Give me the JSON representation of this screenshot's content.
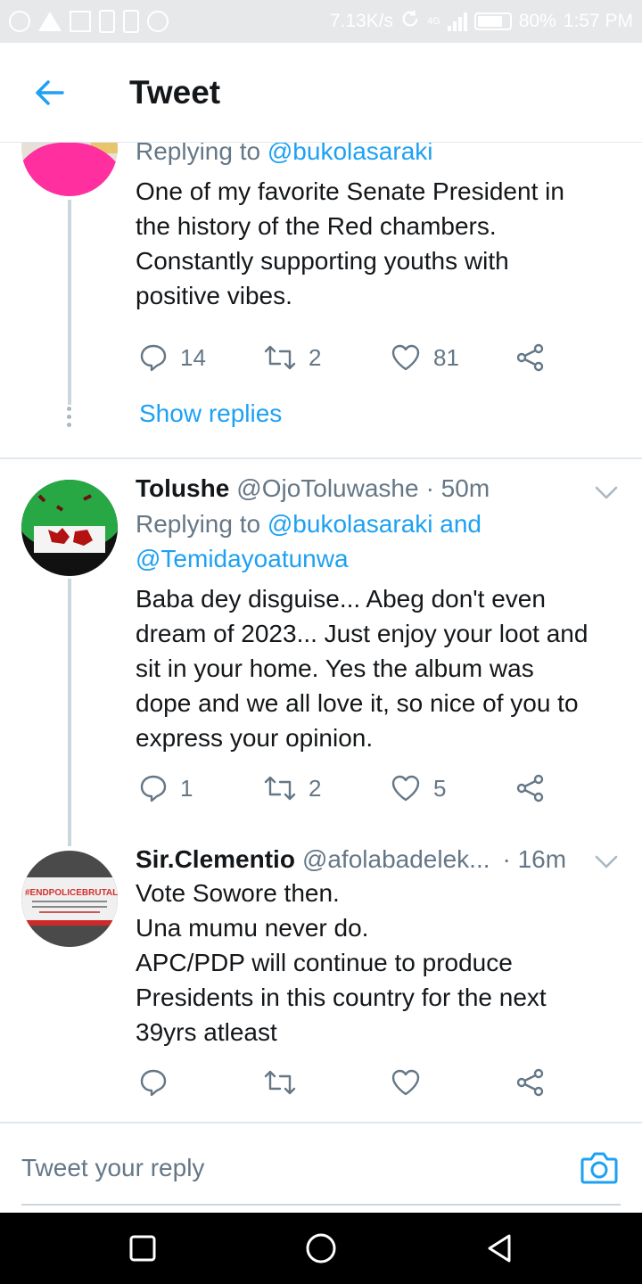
{
  "status_bar": {
    "network_speed": "7.13K/s",
    "network_type": "4G",
    "battery": "80%",
    "battery_level": 0.8,
    "time": "1:57 PM",
    "icons": [
      "circle-notification-icon",
      "warning-icon",
      "image-icon",
      "alert-icon",
      "sim-icon",
      "sync-icon",
      "refresh-icon",
      "signal-icon",
      "battery-icon"
    ]
  },
  "header": {
    "back_icon": "arrow-left-icon",
    "title": "Tweet"
  },
  "colors": {
    "accent": "#1da1f2",
    "text_primary": "#14171a",
    "text_secondary": "#657786",
    "divider": "#e1e8ed"
  },
  "tweets": [
    {
      "replying_prefix": "Replying to ",
      "replying_to": "@bukolasaraki",
      "body_lines": [
        "One of my favorite Senate President in",
        "the history of the Red chambers.",
        "Constantly supporting youths with",
        "positive vibes."
      ],
      "actions": {
        "reply_count": "14",
        "retweet_count": "2",
        "like_count": "81"
      },
      "show_replies": "Show replies"
    },
    {
      "name": "Tolushe",
      "handle": "@OjoToluwashe",
      "time": "· 50m",
      "replying_prefix": "Replying to ",
      "replying_to_line1": "@bukolasaraki and",
      "replying_to_line2": "@Temidayoatunwa",
      "body_lines": [
        "Baba dey disguise... Abeg don't even",
        "dream of 2023... Just enjoy your loot and",
        "sit in your home. Yes the album was",
        "dope and we all love it, so nice of you to",
        "express your opinion."
      ],
      "actions": {
        "reply_count": "1",
        "retweet_count": "2",
        "like_count": "5"
      }
    },
    {
      "name": "Sir.Clementio",
      "handle": "@afolabadelek...",
      "time": "· 16m",
      "avatar_text": "#ENDPOLICEBRUTALITY",
      "body_lines": [
        "Vote Sowore then.",
        "Una mumu never do.",
        "APC/PDP will continue to produce",
        "Presidents in this country for the next",
        "39yrs atleast"
      ],
      "actions": {
        "reply_count": "",
        "retweet_count": "",
        "like_count": ""
      }
    }
  ],
  "reply_bar": {
    "placeholder": "Tweet your reply",
    "camera_icon": "camera-icon"
  },
  "nav_bar": {
    "icons": [
      "square-recents-icon",
      "circle-home-icon",
      "triangle-back-icon"
    ]
  }
}
